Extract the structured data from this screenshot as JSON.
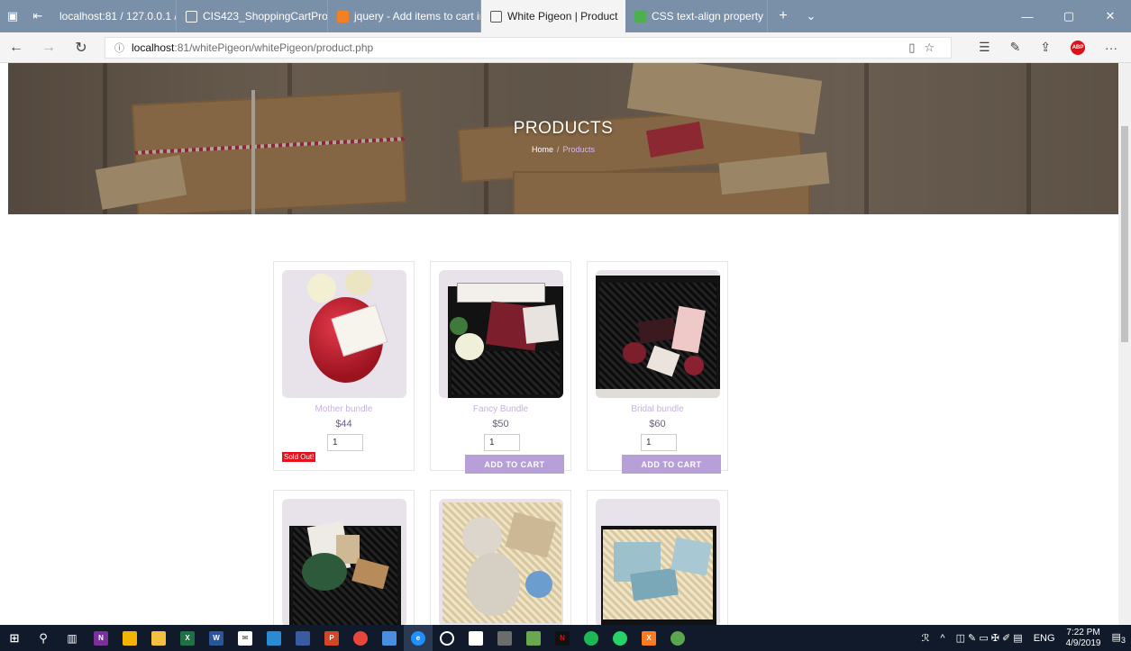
{
  "browser": {
    "tabs": [
      {
        "label": "localhost:81 / 127.0.0.1 / pe",
        "active": false,
        "favicon": "none"
      },
      {
        "label": "CIS423_ShoppingCartProjec",
        "active": false,
        "favicon": "document-icon"
      },
      {
        "label": "jquery - Add items to cart ir",
        "active": false,
        "favicon": "stackoverflow-icon"
      },
      {
        "label": "White Pigeon | Product",
        "active": true,
        "favicon": "page-icon"
      },
      {
        "label": "CSS text-align property",
        "active": false,
        "favicon": "w3schools-icon"
      }
    ],
    "address": {
      "host": "localhost",
      "port": ":81",
      "path": "/whitePigeon/whitePigeon/product.php"
    }
  },
  "hero": {
    "title": "PRODUCTS",
    "breadcrumb_home": "Home",
    "breadcrumb_sep": "/",
    "breadcrumb_current": "Products"
  },
  "products": [
    {
      "name": "Mother bundle",
      "price": "$44",
      "qty": "1",
      "sold_out": "Sold Out!",
      "button": ""
    },
    {
      "name": "Fancy Bundle",
      "price": "$50",
      "qty": "1",
      "sold_out": "",
      "button": "ADD TO CART"
    },
    {
      "name": "Bridal bundle",
      "price": "$60",
      "qty": "1",
      "sold_out": "",
      "button": "ADD TO CART"
    }
  ],
  "taskbar": {
    "language": "ENG",
    "time": "7:22 PM",
    "date": "4/9/2019",
    "notifications": "3"
  },
  "colors": {
    "accent": "#b79fd7",
    "product_name": "#c7b2df",
    "price": "#6f5a8e",
    "sold_out": "#e8101a"
  }
}
